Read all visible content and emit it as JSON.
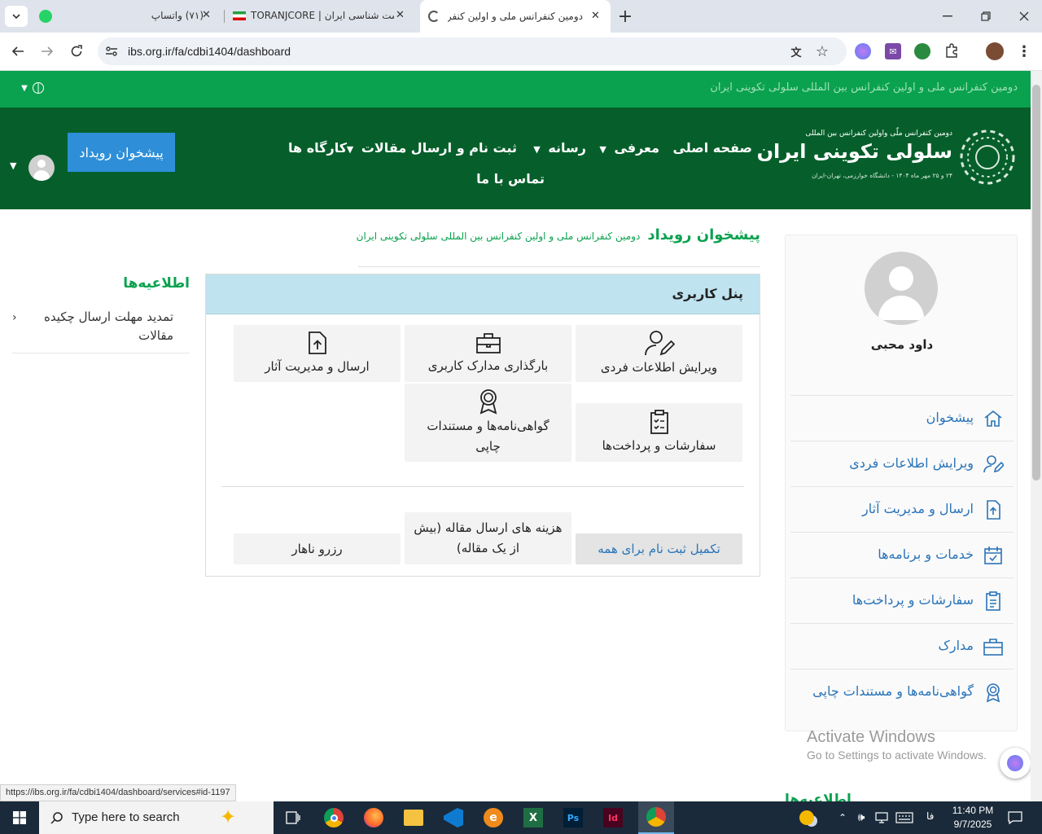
{
  "browser": {
    "tabs": [
      {
        "title": "(۷۱) واتساپ"
      },
      {
        "title": "TORANJCORE | ست شناسی ایران"
      },
      {
        "title": "دومین کنفرانس ملی و اولین کنفرا"
      }
    ],
    "url": "ibs.org.ir/fa/cdbi1404/dashboard",
    "status_url": "https://ibs.org.ir/fa/cdbi1404/dashboard/services#id-1197"
  },
  "site": {
    "banner_text": "دومین کنفرانس ملی و اولین کنفرانس بین المللی سلولی تکوینی ایران",
    "logo": {
      "line1": "دومین کنفرانس ملّی واولین کنفرانس بین المللی",
      "line2": "سلولی تکوینی ایران",
      "line3": "۲۴ و ۲۵ مهر ماه ۱۴۰۴ - دانشگاه خوارزمی، تهران-ایران"
    },
    "nav": {
      "home": "صفحه اصلی",
      "intro": "معرفی",
      "media": "رسانه",
      "register": "ثبت نام و ارسال مقالات",
      "workshops": "کارگاه ها",
      "contact": "تماس با ما"
    },
    "call_button": "پیشخوان رویداد"
  },
  "page": {
    "title": "پیشخوان رویداد",
    "subtitle": "دومین کنفرانس ملی و اولین کنفرانس بین المللی سلولی تکوینی ایران"
  },
  "profile": {
    "name": "داود محبی",
    "menu": [
      {
        "label": "پیشخوان",
        "icon": "home-icon"
      },
      {
        "label": "ویرایش اطلاعات فردی",
        "icon": "user-edit-icon"
      },
      {
        "label": "ارسال و مدیریت آثار",
        "icon": "file-upload-icon"
      },
      {
        "label": "خدمات و برنامه‌ها",
        "icon": "calendar-check-icon"
      },
      {
        "label": "سفارشات و پرداخت‌ها",
        "icon": "clipboard-list-icon"
      },
      {
        "label": "مدارک",
        "icon": "briefcase-icon"
      },
      {
        "label": "گواهی‌نامه‌ها و مستندات چاپی",
        "icon": "award-icon"
      }
    ]
  },
  "panel": {
    "title": "پنل کاربری",
    "cards": {
      "edit_profile": "ویرایش اطلاعات فردی",
      "upload_docs": "بارگذاری مدارک کاربری",
      "submit_works": "ارسال و مدیریت آثار",
      "orders": "سفارشات و پرداخت‌ها",
      "certificates": "گواهی‌نامه‌ها و مستندات چاپی",
      "complete_registration": "تکمیل ثبت نام برای همه",
      "submission_fee": "هزینه های ارسال مقاله (بیش از یک مقاله)",
      "lunch": "رزرو ناهار"
    }
  },
  "notifications": {
    "title": "اطلاعیه‌ها",
    "items": [
      "تمدید مهلت ارسال چکیده مقالات"
    ],
    "bottom_title": "اطلاعیه‌ها"
  },
  "watermark": {
    "line1": "Activate Windows",
    "line2": "Go to Settings to activate Windows."
  },
  "taskbar": {
    "search_placeholder": "Type here to search",
    "lang": "فا",
    "time": "11:40 PM",
    "date": "9/7/2025"
  },
  "colors": {
    "banner_green": "#0aa24f",
    "nav_green": "#065f2b",
    "button_blue": "#2e8fd8",
    "link_blue": "#2a74b8",
    "panel_head": "#bfe3ef"
  }
}
